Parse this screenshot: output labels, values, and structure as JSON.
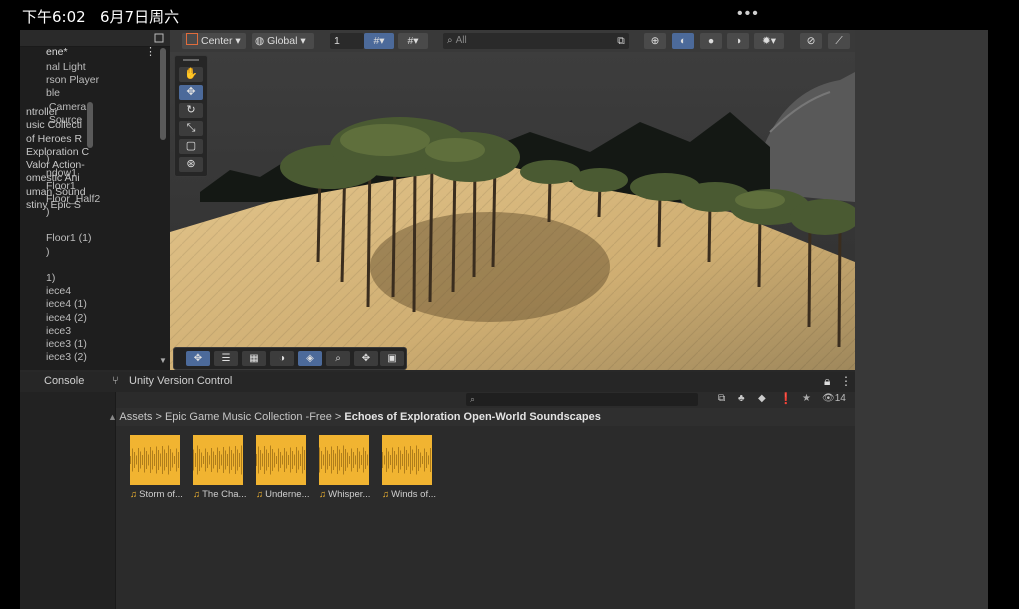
{
  "status": {
    "time": "下午6:02",
    "date": "6月7日周六",
    "dots": "•••"
  },
  "hierarchy": {
    "scene": "ene*",
    "items": [
      "nal Light",
      "rson Player",
      "ble",
      " Camera",
      " Source",
      "",
      "",
      ")",
      "ndow1",
      "Floor1",
      "Floor_Half2",
      ")",
      "",
      "Floor1 (1)",
      ")",
      "",
      "1)",
      "iece4",
      "iece4 (1)",
      "iece4 (2)",
      "iece3",
      "iece3 (1)",
      "iece3 (2)"
    ]
  },
  "scene_toolbar": {
    "pivot": "Center",
    "space": "Global",
    "snap_value": "1",
    "search_placeholder": "All"
  },
  "panel_tabs": {
    "console": "Console",
    "version_control": "Unity Version Control"
  },
  "project": {
    "sidebar_items": [
      "ntroller",
      "usic Collecti",
      "of Heroes R",
      "Exploration C",
      "Valor Action-",
      "omestic Ani",
      "uman Sound",
      "stiny Epic S"
    ],
    "breadcrumb": {
      "root": "Assets",
      "folder": "Epic Game Music Collection -Free",
      "current": "Echoes of Exploration Open-World Soundscapes"
    },
    "count": "14",
    "assets": [
      "Storm of...",
      "The Cha...",
      "Underne...",
      "Whisper...",
      "Winds of..."
    ]
  },
  "colors": {
    "accent": "#4c6a9a",
    "audio": "#f1b431",
    "sand": "#d6b57a"
  }
}
